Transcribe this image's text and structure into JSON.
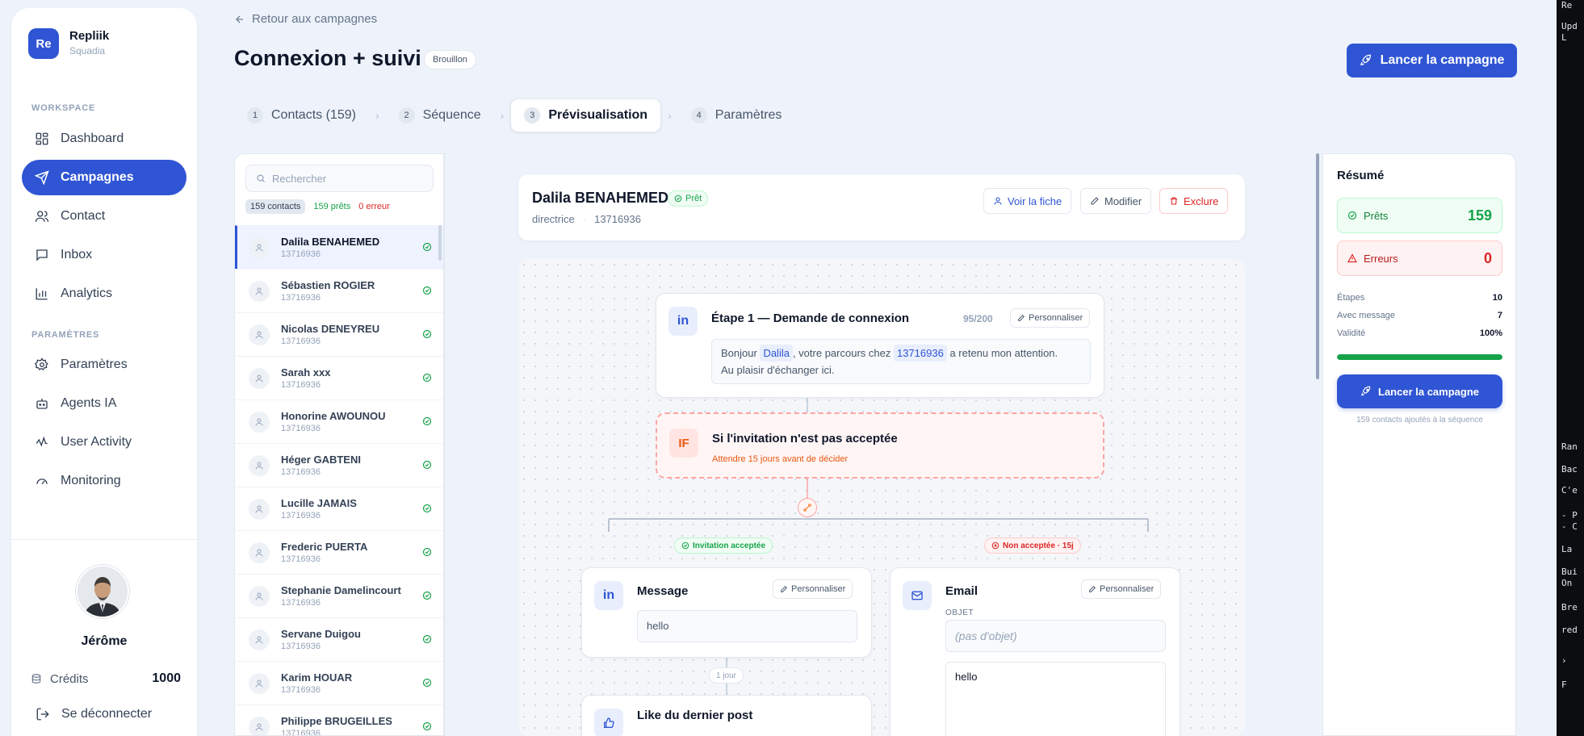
{
  "sidebar": {
    "logo": "Re",
    "brand": "Repliik",
    "brand_sub": "Squadia",
    "workspace_label": "WORKSPACE",
    "workspace_items": [
      {
        "label": "Dashboard",
        "icon": "grid-icon"
      },
      {
        "label": "Campagnes",
        "icon": "send-icon",
        "active": true
      },
      {
        "label": "Contact",
        "icon": "users-icon"
      },
      {
        "label": "Inbox",
        "icon": "inbox-icon"
      },
      {
        "label": "Analytics",
        "icon": "bar-chart-icon"
      }
    ],
    "settings_label": "PARAMÈTRES",
    "settings_items": [
      {
        "label": "Paramètres",
        "icon": "gear-icon"
      },
      {
        "label": "Agents IA",
        "icon": "bot-icon"
      },
      {
        "label": "User Activity",
        "icon": "activity-icon"
      },
      {
        "label": "Monitoring",
        "icon": "gauge-icon"
      }
    ],
    "user_name": "Jérôme",
    "credits_label": "Crédits",
    "credits_value": "1000",
    "logout_label": "Se déconnecter"
  },
  "header": {
    "back_label": "Retour aux campagnes",
    "title": "Connexion + suivi",
    "status_badge": "Brouillon",
    "launch_label": "Lancer la campagne"
  },
  "stepper": [
    {
      "num": "1",
      "label": "Contacts (159)"
    },
    {
      "num": "2",
      "label": "Séquence"
    },
    {
      "num": "3",
      "label": "Prévisualisation",
      "active": true
    },
    {
      "num": "4",
      "label": "Paramètres"
    }
  ],
  "contacts_panel": {
    "search_placeholder": "Rechercher",
    "count_total": "159 contacts",
    "count_ready": "159 prêts",
    "count_error": "0 erreur",
    "contacts": [
      {
        "name": "Dalila BENAHEMED",
        "id": "13716936",
        "active": true
      },
      {
        "name": "Sébastien ROGIER",
        "id": "13716936"
      },
      {
        "name": "Nicolas DENEYREU",
        "id": "13716936"
      },
      {
        "name": "Sarah xxx",
        "id": "13716936"
      },
      {
        "name": "Honorine AWOUNOU",
        "id": "13716936"
      },
      {
        "name": "Héger GABTENI",
        "id": "13716936"
      },
      {
        "name": "Lucille JAMAIS",
        "id": "13716936"
      },
      {
        "name": "Frederic PUERTA",
        "id": "13716936"
      },
      {
        "name": "Stephanie Damelincourt",
        "id": "13716936"
      },
      {
        "name": "Servane Duigou",
        "id": "13716936"
      },
      {
        "name": "Karim HOUAR",
        "id": "13716936"
      },
      {
        "name": "Philippe BRUGEILLES",
        "id": "13716936"
      }
    ]
  },
  "contact_card": {
    "name": "Dalila BENAHEMED",
    "status": "Prêt",
    "role": "directrice",
    "company": "13716936",
    "view_label": "Voir la fiche",
    "edit_label": "Modifier",
    "exclude_label": "Exclure"
  },
  "flow": {
    "step1": {
      "badge": "in",
      "title": "Étape 1 — Demande de connexion",
      "char_count": "95/200",
      "customize_label": "Personnaliser",
      "msg_before": "Bonjour",
      "var_firstname": "Dalila",
      "msg_mid": ", votre parcours chez",
      "var_company": "13716936",
      "msg_after": "a retenu mon attention.",
      "msg_line2": "Au plaisir d'échanger ici."
    },
    "condition": {
      "badge": "IF",
      "title": "Si l'invitation n'est pas acceptée",
      "subtitle": "Attendre 15 jours avant de décider"
    },
    "branch_accepted": "Invitation acceptée",
    "branch_rejected": "Non acceptée · 15j",
    "message_node": {
      "badge": "in",
      "title": "Message",
      "customize_label": "Personnaliser",
      "body": "hello"
    },
    "delay_label": "1 jour",
    "like_node": {
      "title": "Like du dernier post"
    },
    "email_node": {
      "title": "Email",
      "customize_label": "Personnaliser",
      "subject_label": "OBJET",
      "subject_placeholder": "(pas d'objet)",
      "body": "hello"
    }
  },
  "summary": {
    "title": "Résumé",
    "ready_label": "Prêts",
    "ready_value": "159",
    "errors_label": "Erreurs",
    "errors_value": "0",
    "rows": [
      {
        "label": "Étapes",
        "value": "10"
      },
      {
        "label": "Avec message",
        "value": "7"
      },
      {
        "label": "Validité",
        "value": "100%"
      }
    ],
    "validity_fraction": 1.0,
    "launch_label": "Lancer la campagne",
    "note": "159 contacts ajoutés à la séquence"
  },
  "terminal_fragment": {
    "lines": [
      "Re",
      "Upd",
      "L",
      "Ran",
      "Bac",
      "C'e",
      "- P",
      "- C",
      "La",
      "Bui",
      "On",
      "Bre",
      "red",
      "›",
      "F"
    ]
  },
  "colors": {
    "accent": "#2f55d4",
    "success": "#16a34a",
    "danger": "#dc2626",
    "background": "#eef3fb"
  }
}
